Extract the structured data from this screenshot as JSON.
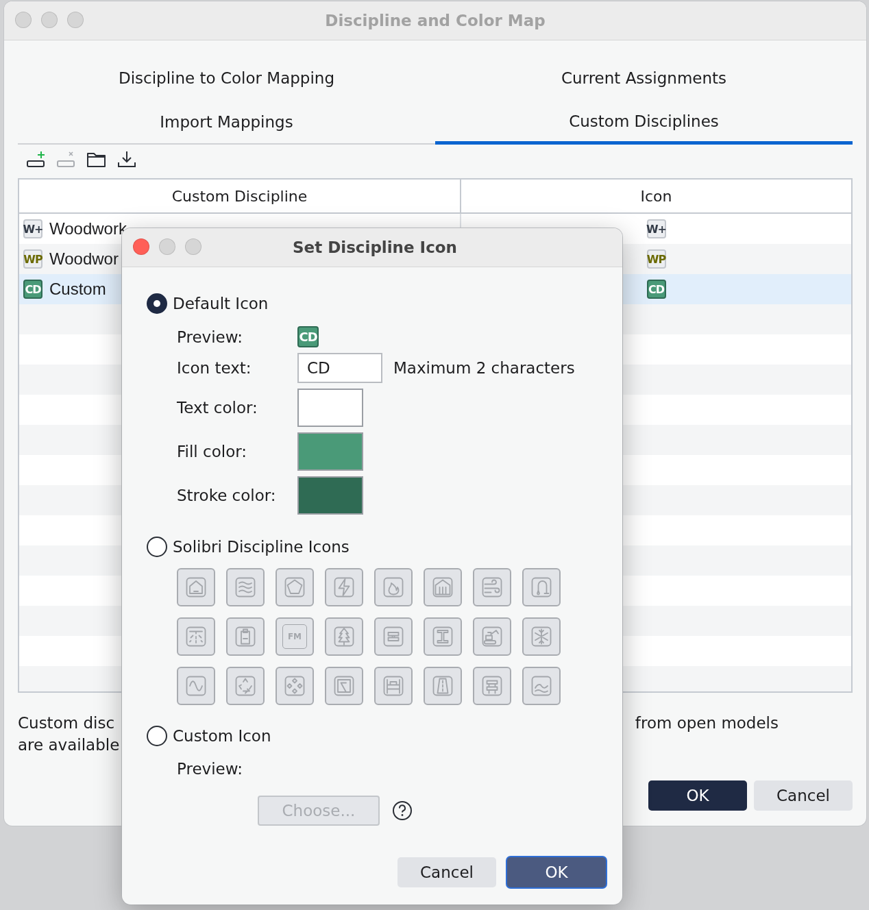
{
  "window": {
    "title": "Discipline and Color Map"
  },
  "tabs": [
    {
      "label": "Discipline to Color Mapping",
      "selected": false
    },
    {
      "label": "Current Assignments",
      "selected": false
    },
    {
      "label": "Import Mappings",
      "selected": false
    },
    {
      "label": "Custom Disciplines",
      "selected": true
    }
  ],
  "toolbar": [
    {
      "kind": "add",
      "disabled": false
    },
    {
      "kind": "remove",
      "disabled": true
    },
    {
      "kind": "folder",
      "disabled": false
    },
    {
      "kind": "download",
      "disabled": false
    }
  ],
  "table": {
    "columns": [
      "Custom Discipline",
      "Icon"
    ],
    "rows": [
      {
        "name": "Woodwork",
        "badge": {
          "text": "W+",
          "ink": {
            "color": "#333b47"
          },
          "fill": {
            "color": "#eceef1"
          },
          "stroke": {
            "color": "#c3c7cd"
          }
        },
        "icon": {
          "text": "W+",
          "ink": {
            "color": "#333b47"
          },
          "fill": {
            "color": "#eceef1"
          },
          "stroke": {
            "color": "#c3c7cd"
          }
        },
        "selected": false
      },
      {
        "name": "Woodwor",
        "badge": {
          "text": "WP",
          "ink": {
            "color": "#6b6a00"
          },
          "fill": {
            "color": "#eceef1"
          },
          "stroke": {
            "color": "#c3c7cd"
          }
        },
        "icon": {
          "text": "WP",
          "ink": {
            "color": "#6b6a00"
          },
          "fill": {
            "color": "#eceef1"
          },
          "stroke": {
            "color": "#c3c7cd"
          }
        },
        "selected": false
      },
      {
        "name": "Custom",
        "badge": {
          "text": "CD",
          "ink": {
            "color": "#ffffff"
          },
          "fill": {
            "color": "#4a9a78"
          },
          "stroke": {
            "color": "#2f6b54"
          }
        },
        "icon": {
          "text": "CD",
          "ink": {
            "color": "#ffffff"
          },
          "fill": {
            "color": "#4a9a78"
          },
          "stroke": {
            "color": "#2f6b54"
          }
        },
        "selected": true
      }
    ]
  },
  "note": {
    "left_lines": [
      "Custom disc",
      "are available"
    ],
    "right": "from open models"
  },
  "buttons": [
    {
      "label": "OK",
      "kind": "primary"
    },
    {
      "label": "Cancel",
      "kind": "secondary"
    }
  ],
  "dialog": {
    "title": "Set Discipline Icon",
    "default_icon": {
      "label": "Default Icon",
      "selected": true,
      "preview_label": "Preview:",
      "preview_text": "CD",
      "icon_text_label": "Icon text:",
      "icon_text_value": "CD",
      "icon_text_hint": "Maximum 2 characters",
      "swatches": [
        {
          "label": "Text color:",
          "color": "#ffffff"
        },
        {
          "label": "Fill color:",
          "color": "#4a9a78"
        },
        {
          "label": "Stroke color:",
          "color": "#2f6b54"
        }
      ]
    },
    "solibri_icons": {
      "label": "Solibri Discipline Icons",
      "selected": false,
      "icons": [
        {
          "kind": "house"
        },
        {
          "kind": "waves"
        },
        {
          "kind": "pentagon"
        },
        {
          "kind": "bolt"
        },
        {
          "kind": "flame"
        },
        {
          "kind": "building"
        },
        {
          "kind": "wind"
        },
        {
          "kind": "pipe"
        },
        {
          "kind": "sprinkler"
        },
        {
          "kind": "clipboard"
        },
        {
          "kind": "text",
          "text": "FM"
        },
        {
          "kind": "tree"
        },
        {
          "kind": "duct"
        },
        {
          "kind": "beam"
        },
        {
          "kind": "excavator"
        },
        {
          "kind": "snowflake"
        },
        {
          "kind": "sine"
        },
        {
          "kind": "recycle"
        },
        {
          "kind": "diamonds"
        },
        {
          "kind": "plot"
        },
        {
          "kind": "bed"
        },
        {
          "kind": "road"
        },
        {
          "kind": "bench"
        },
        {
          "kind": "sea"
        }
      ]
    },
    "custom_icon": {
      "label": "Custom Icon",
      "selected": false,
      "preview_label": "Preview:",
      "choose_button": {
        "label": "Choose...",
        "disabled": true
      }
    },
    "buttons": [
      {
        "label": "Cancel",
        "kind": "secondary"
      },
      {
        "label": "OK",
        "kind": "primary"
      }
    ]
  }
}
